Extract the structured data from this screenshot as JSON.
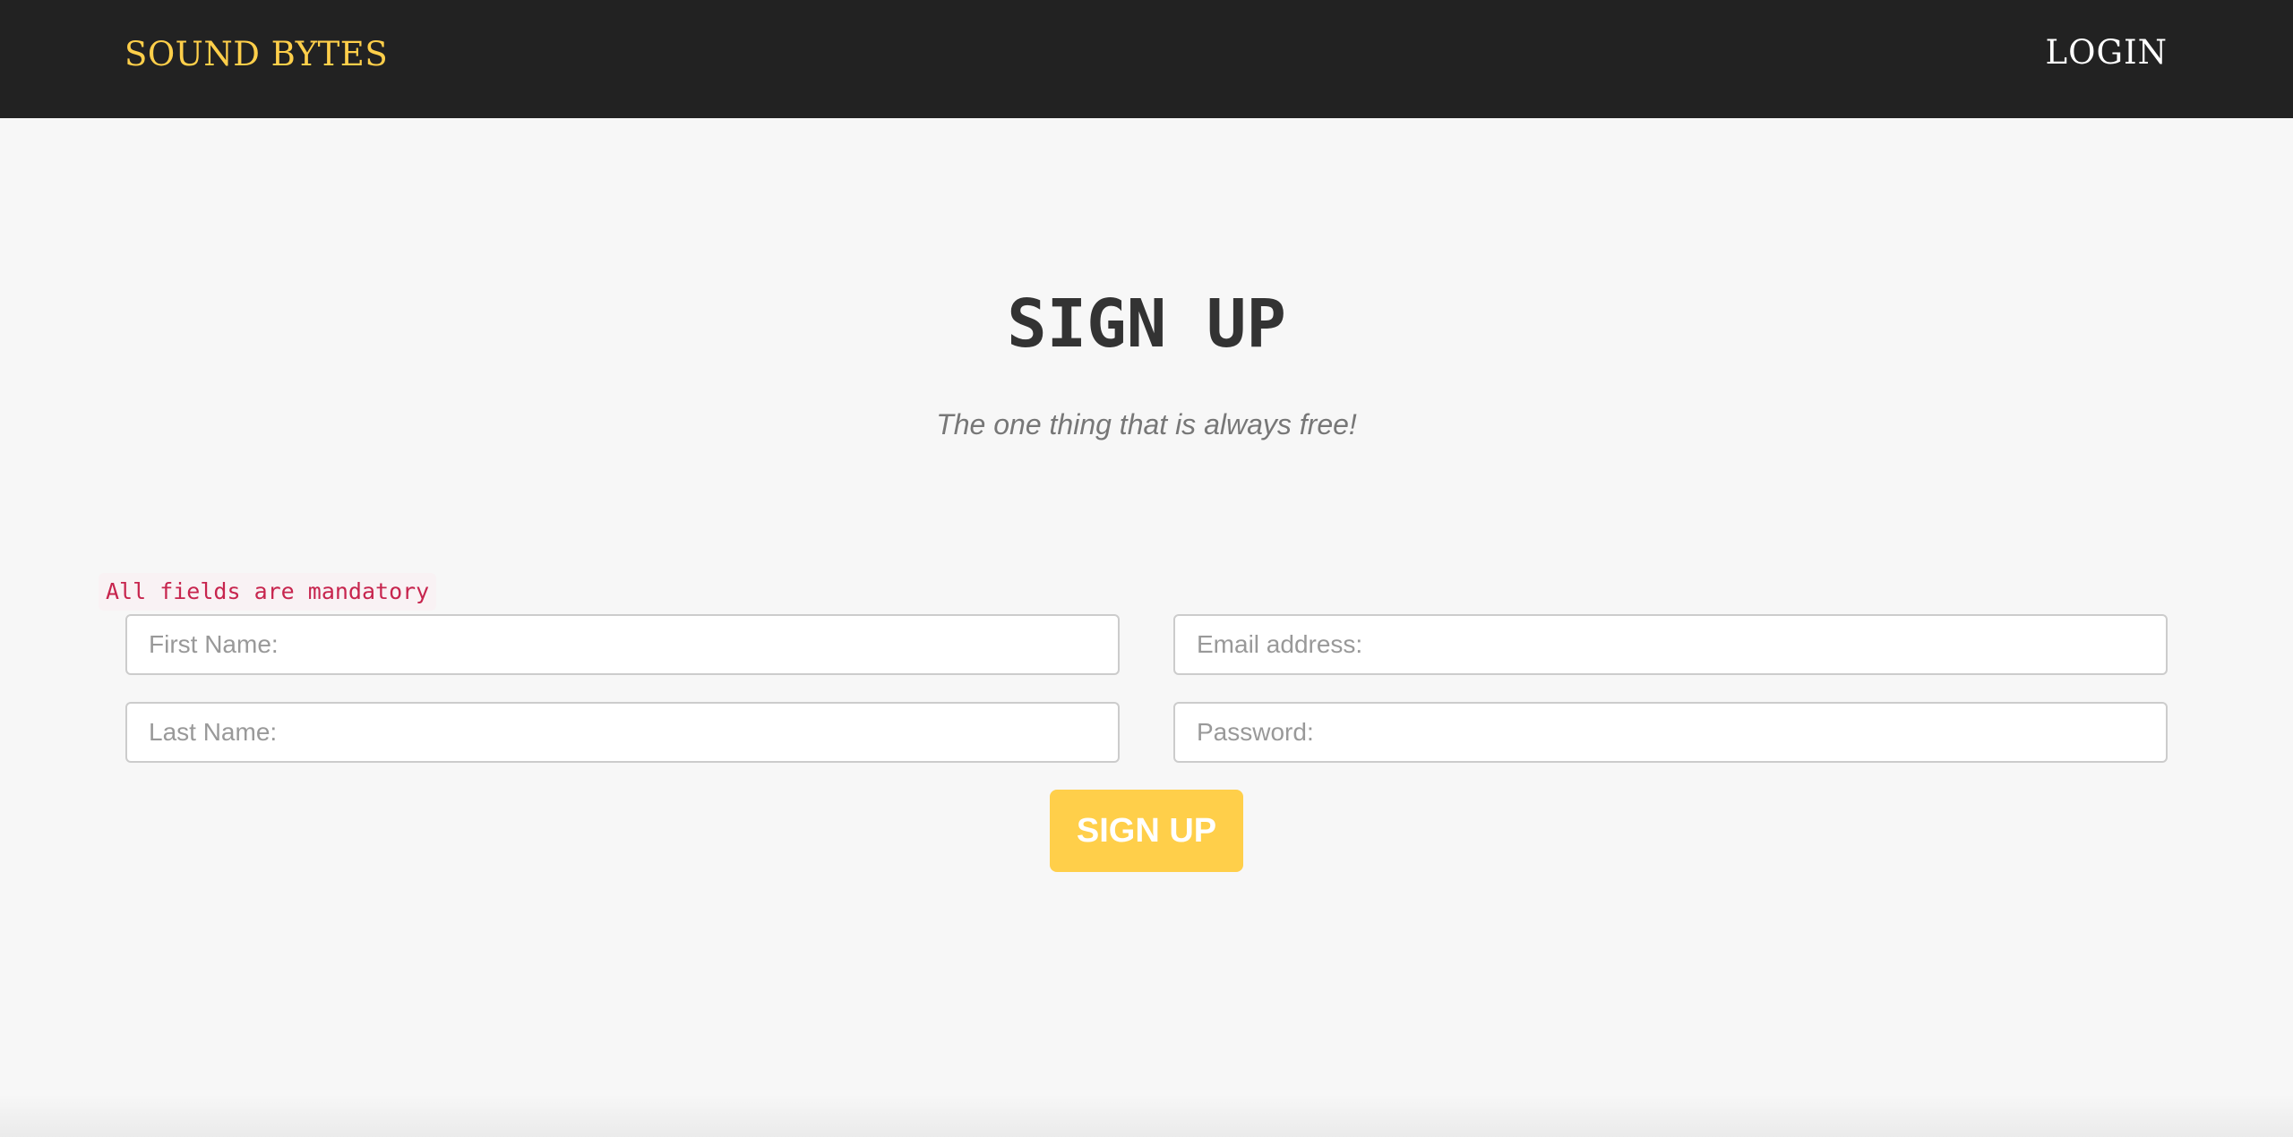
{
  "navbar": {
    "brand": "SOUND BYTES",
    "login_label": "LOGIN"
  },
  "main": {
    "title": "SIGN UP",
    "subtitle": "The one thing that is always free!",
    "mandatory_note": "All fields are mandatory"
  },
  "form": {
    "first_name": {
      "placeholder": "First Name:",
      "value": ""
    },
    "email": {
      "placeholder": "Email address:",
      "value": ""
    },
    "last_name": {
      "placeholder": "Last Name:",
      "value": ""
    },
    "password": {
      "placeholder": "Password:",
      "value": ""
    },
    "submit_label": "SIGN UP"
  },
  "colors": {
    "navbar_bg": "#222222",
    "brand": "#ffcf4a",
    "login": "#ffffff",
    "accent_button": "#ffcf4a",
    "mandatory_text": "#c7254e",
    "page_bg": "#f7f7f7"
  }
}
